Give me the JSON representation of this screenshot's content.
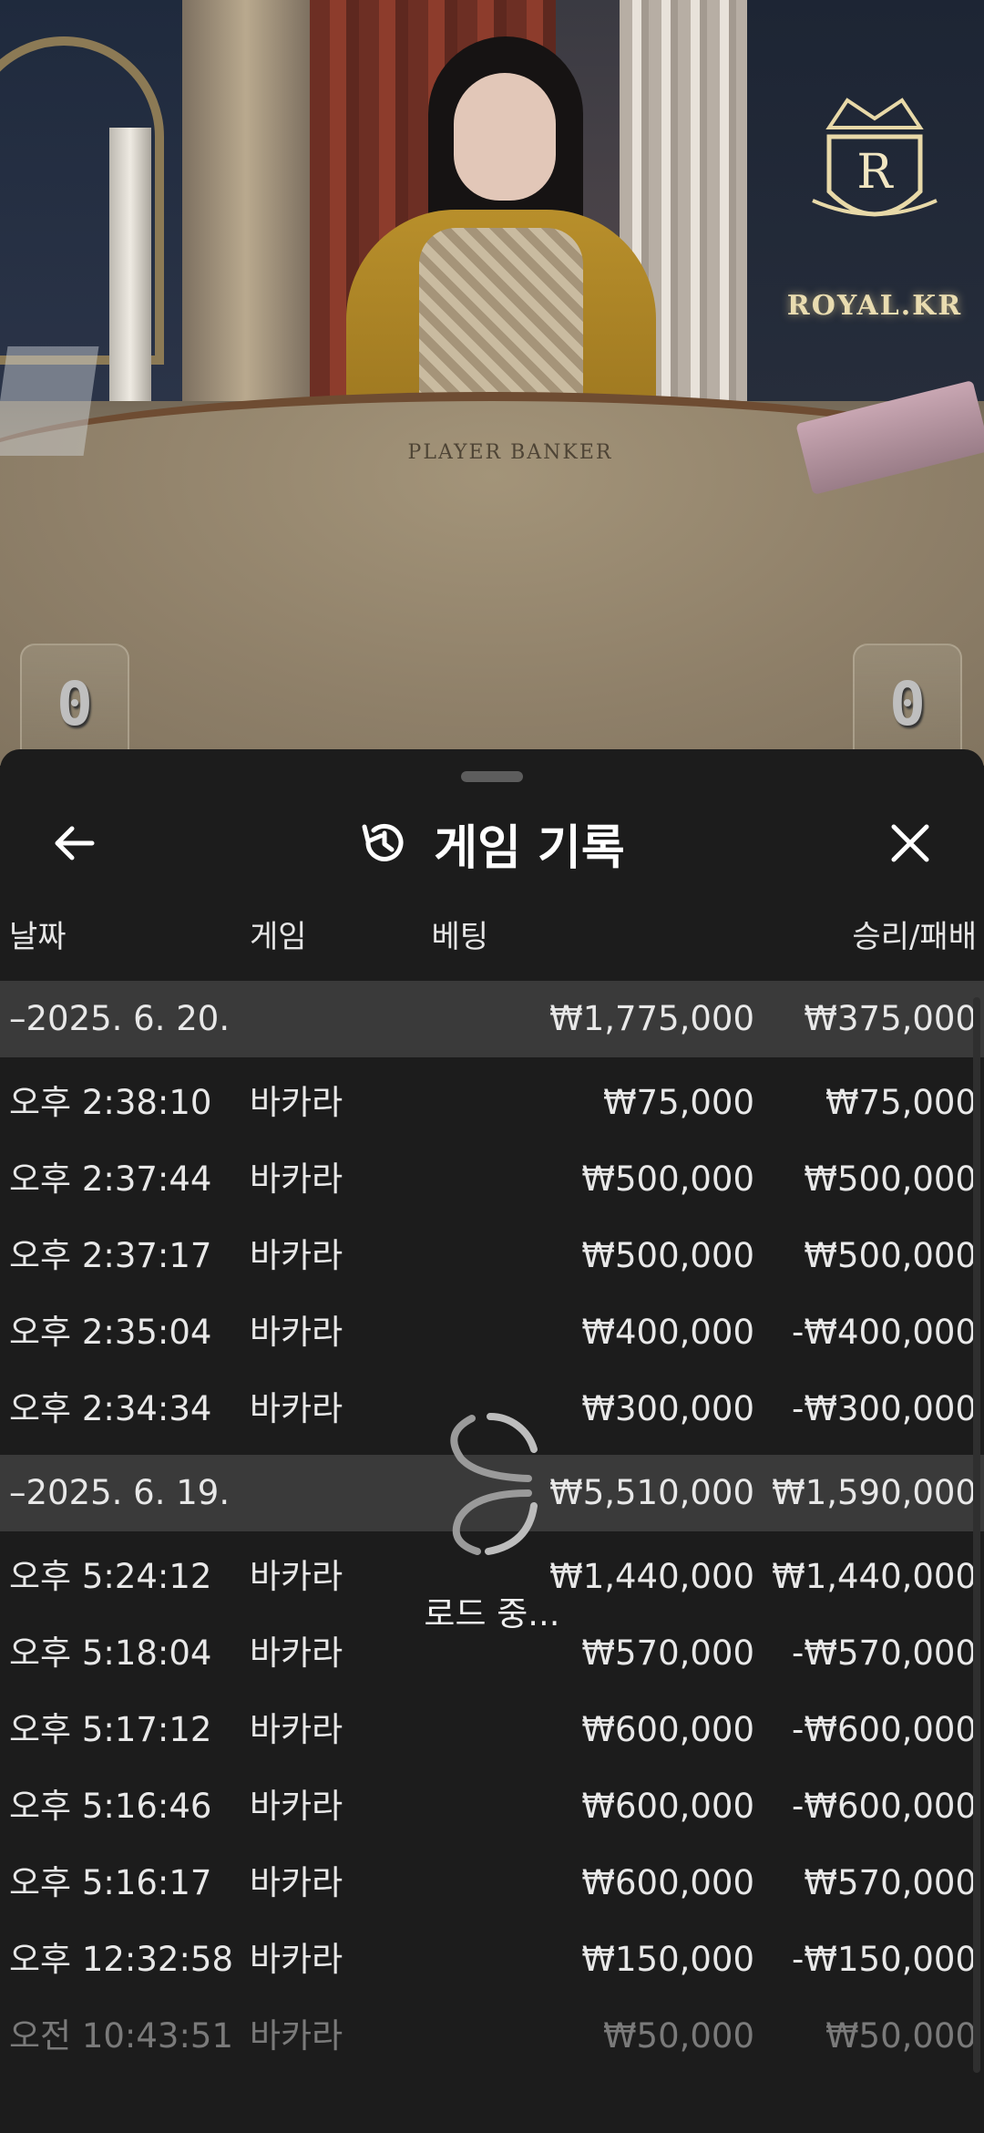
{
  "video": {
    "brand_logo": "ROYAL.KR",
    "table_label": "PLAYER    BANKER",
    "player_score": "0",
    "banker_score": "0"
  },
  "sheet": {
    "title": "게임 기록",
    "icons": {
      "back": "arrow-left-icon",
      "history": "history-icon",
      "close": "close-icon"
    },
    "columns": {
      "date": "날짜",
      "game": "게임",
      "bet": "베팅",
      "result": "승리/패배"
    },
    "loading_text": "로드 중..."
  },
  "groups": [
    {
      "date": "–2025. 6. 20.",
      "bet_total": "₩1,775,000",
      "result_total": "₩375,000",
      "rows": [
        {
          "time": "오후 2:38:10",
          "game": "바카라",
          "bet": "₩75,000",
          "result": "₩75,000"
        },
        {
          "time": "오후 2:37:44",
          "game": "바카라",
          "bet": "₩500,000",
          "result": "₩500,000"
        },
        {
          "time": "오후 2:37:17",
          "game": "바카라",
          "bet": "₩500,000",
          "result": "₩500,000"
        },
        {
          "time": "오후 2:35:04",
          "game": "바카라",
          "bet": "₩400,000",
          "result": "-₩400,000"
        },
        {
          "time": "오후 2:34:34",
          "game": "바카라",
          "bet": "₩300,000",
          "result": "-₩300,000"
        }
      ]
    },
    {
      "date": "–2025. 6. 19.",
      "bet_total": "₩5,510,000",
      "result_total": "₩1,590,000",
      "rows": [
        {
          "time": "오후 5:24:12",
          "game": "바카라",
          "bet": "₩1,440,000",
          "result": "₩1,440,000"
        },
        {
          "time": "오후 5:18:04",
          "game": "바카라",
          "bet": "₩570,000",
          "result": "-₩570,000"
        },
        {
          "time": "오후 5:17:12",
          "game": "바카라",
          "bet": "₩600,000",
          "result": "-₩600,000"
        },
        {
          "time": "오후 5:16:46",
          "game": "바카라",
          "bet": "₩600,000",
          "result": "-₩600,000"
        },
        {
          "time": "오후 5:16:17",
          "game": "바카라",
          "bet": "₩600,000",
          "result": "₩570,000"
        },
        {
          "time": "오후 12:32:58",
          "game": "바카라",
          "bet": "₩150,000",
          "result": "-₩150,000"
        },
        {
          "time": "오전 10:43:51",
          "game": "바카라",
          "bet": "₩50,000",
          "result": "₩50,000"
        }
      ]
    }
  ]
}
